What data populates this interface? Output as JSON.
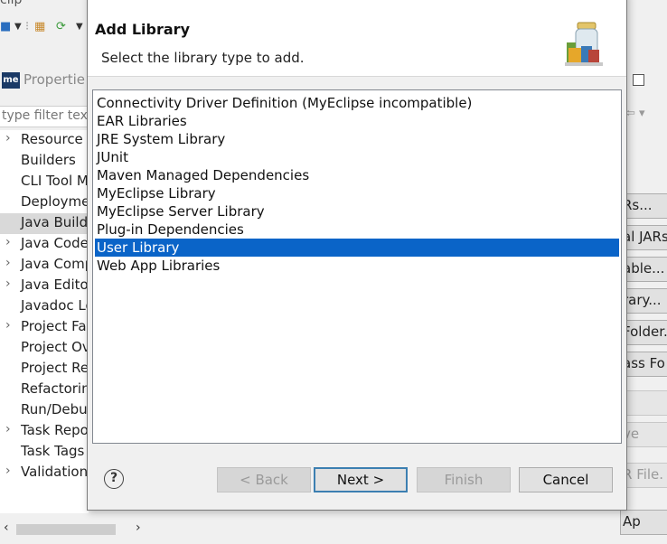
{
  "background": {
    "window_title_fragment": "clip",
    "properties_title": "Propertie",
    "filter_placeholder": "type filter tex",
    "tree_items": [
      {
        "label": "Resource",
        "expandable": true
      },
      {
        "label": "Builders",
        "expandable": false
      },
      {
        "label": "CLI Tool M",
        "expandable": false
      },
      {
        "label": "Deployme",
        "expandable": false
      },
      {
        "label": "Java Build",
        "expandable": false,
        "selected": true
      },
      {
        "label": "Java Code",
        "expandable": true
      },
      {
        "label": "Java Comp",
        "expandable": true
      },
      {
        "label": "Java Edito",
        "expandable": true
      },
      {
        "label": "Javadoc Lo",
        "expandable": false
      },
      {
        "label": "Project Fa",
        "expandable": true
      },
      {
        "label": "Project Ov",
        "expandable": false
      },
      {
        "label": "Project Re",
        "expandable": false
      },
      {
        "label": "Refactorin",
        "expandable": false
      },
      {
        "label": "Run/Debu",
        "expandable": false
      },
      {
        "label": "Task Repo",
        "expandable": true
      },
      {
        "label": "Task Tags",
        "expandable": false
      },
      {
        "label": "Validation",
        "expandable": true
      }
    ],
    "right_buttons": [
      {
        "label": "Rs...",
        "disabled": false
      },
      {
        "label": "al JARs",
        "disabled": false
      },
      {
        "label": "able...",
        "disabled": false
      },
      {
        "label": "rary...",
        "disabled": false
      },
      {
        "label": "Folder..",
        "disabled": false
      },
      {
        "label": "ass Fo",
        "disabled": false
      },
      {
        "label": "",
        "disabled": true
      },
      {
        "label": "ve",
        "disabled": true
      },
      {
        "label": "R File.",
        "disabled": true
      },
      {
        "label": "Ap",
        "disabled": false
      }
    ]
  },
  "dialog": {
    "title": "Add Library",
    "description": "Select the library type to add.",
    "library_types": [
      {
        "label": "Connectivity Driver Definition (MyEclipse incompatible)",
        "selected": false
      },
      {
        "label": "EAR Libraries",
        "selected": false
      },
      {
        "label": "JRE System Library",
        "selected": false
      },
      {
        "label": "JUnit",
        "selected": false
      },
      {
        "label": "Maven Managed Dependencies",
        "selected": false
      },
      {
        "label": "MyEclipse Library",
        "selected": false
      },
      {
        "label": "MyEclipse Server Library",
        "selected": false
      },
      {
        "label": "Plug-in Dependencies",
        "selected": false
      },
      {
        "label": "User Library",
        "selected": true
      },
      {
        "label": "Web App Libraries",
        "selected": false
      }
    ],
    "buttons": {
      "help": "?",
      "back": "< Back",
      "next": "Next >",
      "finish": "Finish",
      "cancel": "Cancel"
    },
    "colors": {
      "selection": "#0a64c8",
      "default_button_border": "#3c7fb1"
    }
  }
}
